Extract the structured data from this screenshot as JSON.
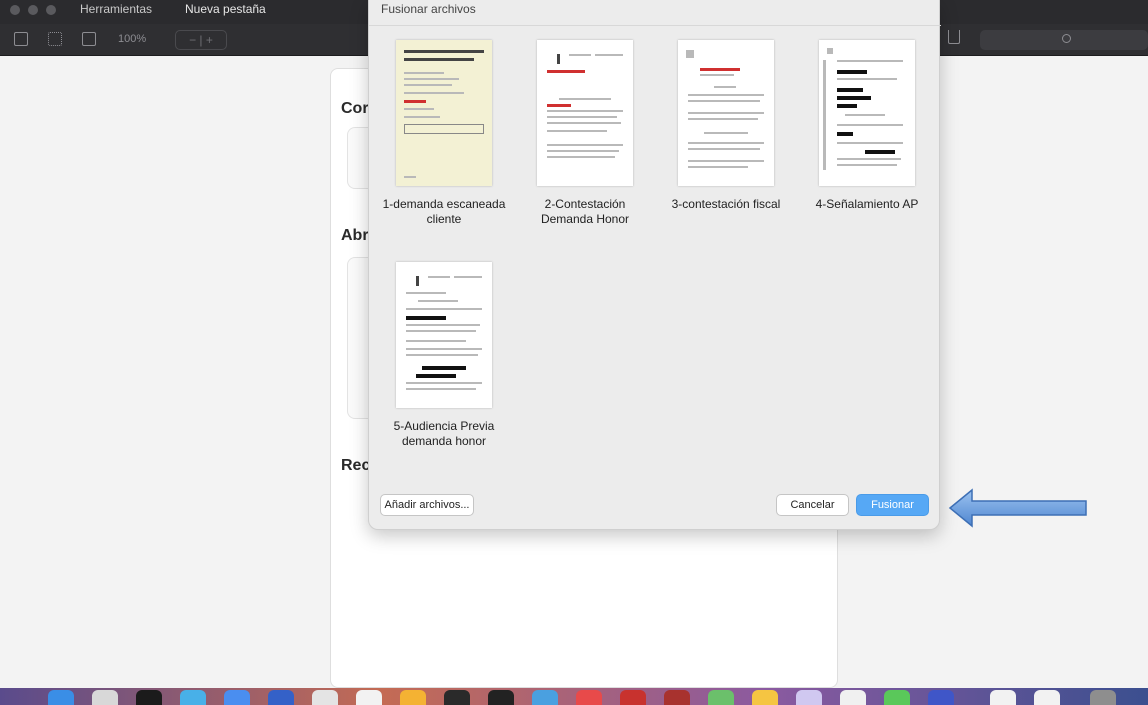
{
  "window": {
    "tab_herramientas": "Herramientas",
    "tab_nueva": "Nueva pestaña",
    "zoom": "100%",
    "zoom_controls": "−  |  +"
  },
  "background": {
    "heading_1": "Cor",
    "heading_2": "Abr",
    "heading_3": "Rec"
  },
  "dialog": {
    "title": "Fusionar archivos",
    "files": [
      {
        "name": "1-demanda escaneada cliente"
      },
      {
        "name": "2-Contestación Demanda Honor"
      },
      {
        "name": "3-contestación fiscal"
      },
      {
        "name": "4-Señalamiento AP"
      },
      {
        "name": "5-Audiencia Previa demanda honor"
      }
    ],
    "add_files_label": "Añadir archivos...",
    "cancel_label": "Cancelar",
    "merge_label": "Fusionar"
  },
  "colors": {
    "accent": "#56a8f5",
    "arrow": "#6a9ee0"
  },
  "icons": [
    "sidebar-icon",
    "grid-icon",
    "two-page-icon",
    "share-icon",
    "search-icon",
    "arrow-left-icon"
  ]
}
